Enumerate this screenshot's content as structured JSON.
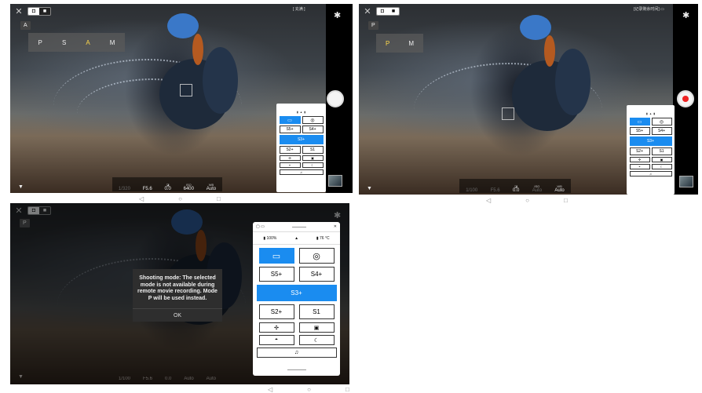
{
  "screen_a": {
    "status": "[ 充满 ]",
    "mode_badge": "A",
    "pasm": [
      {
        "label": "P",
        "selected": false
      },
      {
        "label": "S",
        "selected": false
      },
      {
        "label": "A",
        "selected": true
      },
      {
        "label": "M",
        "selected": false
      }
    ],
    "bottom": [
      {
        "key": "",
        "value": "1/320",
        "dim": true
      },
      {
        "key": "",
        "value": "F5.6",
        "dim": false
      },
      {
        "key": "◪",
        "value": "0.0",
        "dim": false
      },
      {
        "key": "ISO",
        "value": "6400",
        "dim": false
      },
      {
        "key": "WB",
        "value": "Auto",
        "dim": false
      }
    ]
  },
  "screen_b": {
    "status": "[记录剩余时间] ▭",
    "mode_badge": "P",
    "pasm": [
      {
        "label": "P",
        "selected": true
      },
      {
        "label": "M",
        "selected": false
      }
    ],
    "bottom": [
      {
        "key": "",
        "value": "1/100",
        "dim": true
      },
      {
        "key": "",
        "value": "F5.6",
        "dim": true
      },
      {
        "key": "◪",
        "value": "0.0",
        "dim": false
      },
      {
        "key": "ISO",
        "value": "Auto",
        "dim": true
      },
      {
        "key": "WB",
        "value": "Auto",
        "dim": false
      }
    ]
  },
  "screen_c": {
    "mode_badge": "P",
    "dialog_message": "Shooting mode: The selected mode is not available during remote movie recording. Mode P will be used instead.",
    "dialog_ok": "OK",
    "bottom_values": [
      "1/100",
      "F5.6",
      "0.0",
      "Auto",
      "Auto"
    ]
  },
  "panel": {
    "info_battery": "100%",
    "info_temp": "76 °C",
    "drive_modes": {
      "single_frame": "▭",
      "self_timer": "◎",
      "s5": "S5+",
      "s4": "S4+",
      "s3": "S3+",
      "s2": "S2+",
      "s1": "S1"
    }
  },
  "navbar": {
    "back": "◁",
    "home": "○",
    "recents": "□"
  }
}
